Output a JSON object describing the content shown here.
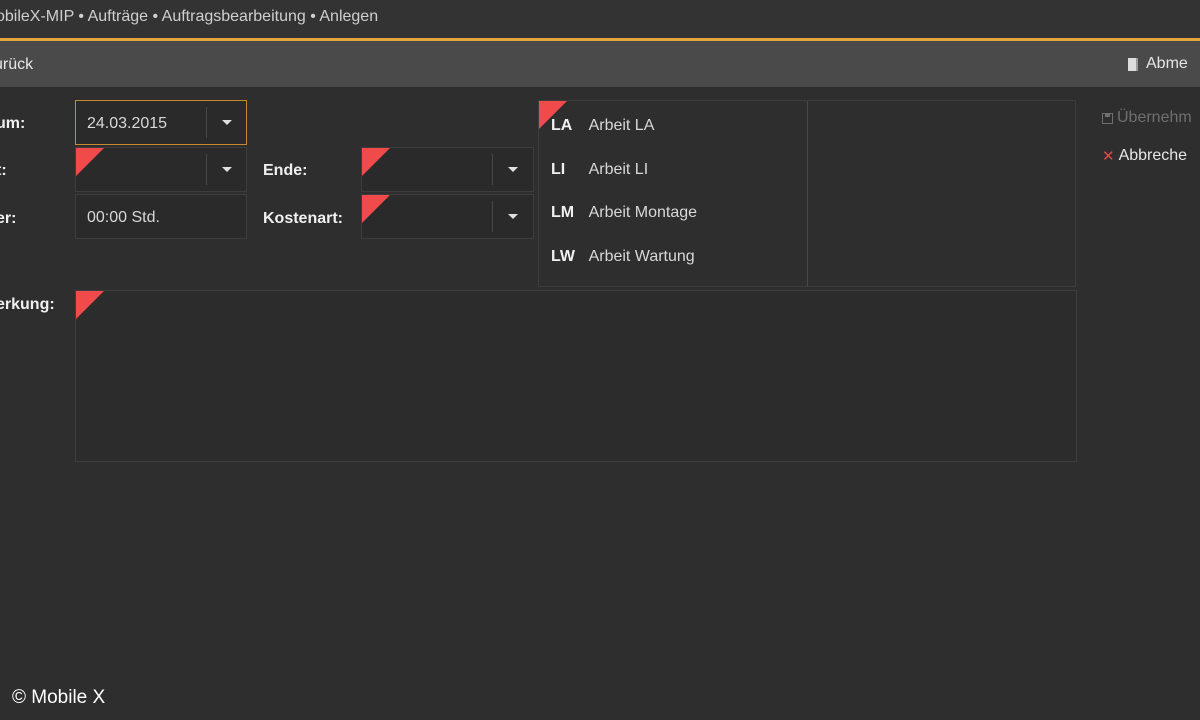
{
  "window": {
    "breadcrumb": "obileX-MIP • Aufträge • Auftragsbearbeitung • Anlegen"
  },
  "colors": {
    "accent": "#e3a63a",
    "required_marker": "#f04a4a",
    "background": "#2e2e2e"
  },
  "toolbar": {
    "back_label": "urück",
    "logout_label": "Abme",
    "logout_icon": "door-icon"
  },
  "form": {
    "datum": {
      "label": "um:",
      "value": "24.03.2015"
    },
    "start": {
      "label": "t:",
      "value": ""
    },
    "dauer": {
      "label": "er:",
      "value": "00:00 Std."
    },
    "ende": {
      "label": "Ende:",
      "value": ""
    },
    "kostenart": {
      "label": "Kostenart:",
      "value": ""
    },
    "bemerkung": {
      "label": "erkung:",
      "value": ""
    }
  },
  "activity_list": [
    {
      "code": "LA",
      "name": "Arbeit LA"
    },
    {
      "code": "LI",
      "name": "Arbeit LI"
    },
    {
      "code": "LM",
      "name": "Arbeit Montage"
    },
    {
      "code": "LW",
      "name": "Arbeit Wartung"
    }
  ],
  "actions": {
    "apply_label": "Übernehm",
    "cancel_label": "Abbreche"
  },
  "footer": {
    "copyright": "© Mobile X"
  }
}
